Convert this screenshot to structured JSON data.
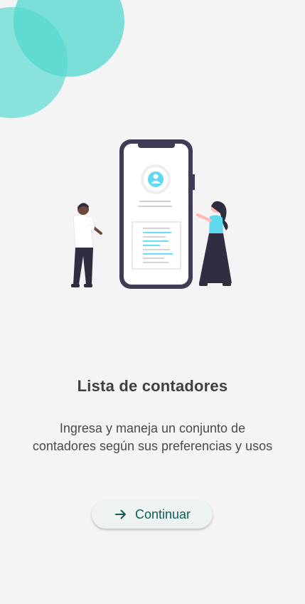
{
  "onboarding": {
    "title": "Lista de contadores",
    "description": "Ingresa y maneja un conjunto de contadores según sus preferencias y usos",
    "illustration": "person-with-phone-profile-illustration"
  },
  "cta": {
    "label": "Continuar",
    "icon": "arrow-right-icon"
  },
  "colors": {
    "background": "#f4f4f4",
    "accent_teal": "#4fd6cc",
    "cta_text": "#0b5e55",
    "title": "#3f3f3f"
  }
}
